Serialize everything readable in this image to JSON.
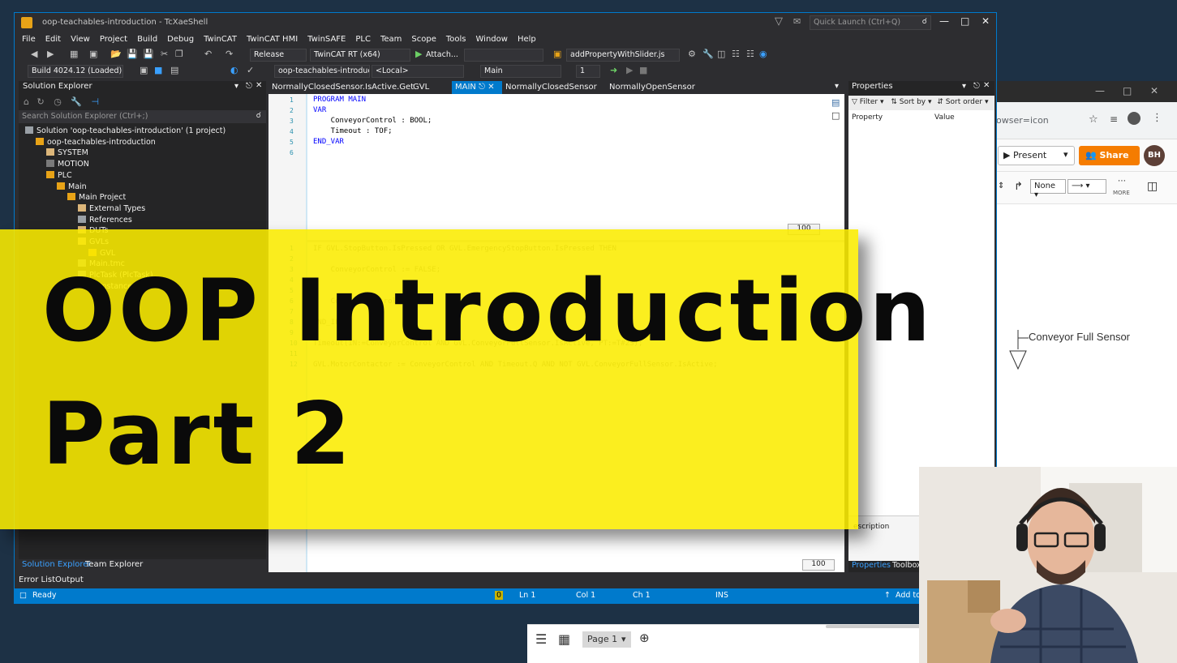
{
  "ide": {
    "title": "oop-teachables-introduction - TcXaeShell",
    "quick_launch": "Quick Launch (Ctrl+Q)",
    "menu": [
      "File",
      "Edit",
      "View",
      "Project",
      "Build",
      "Debug",
      "TwinCAT",
      "TwinCAT HMI",
      "TwinSAFE",
      "PLC",
      "Team",
      "Scope",
      "Tools",
      "Window",
      "Help"
    ],
    "toolbar1": {
      "config": "Release",
      "platform": "TwinCAT RT (x64)",
      "attach": "Attach...",
      "script": "addPropertyWithSlider.js"
    },
    "toolbar2": {
      "build": "Build 4024.12 (Loaded)",
      "project": "oop-teachables-introduc",
      "target": "<Local>",
      "task": "Main",
      "instance": "1"
    },
    "solution_explorer": {
      "header": "Solution Explorer",
      "search_placeholder": "Search Solution Explorer (Ctrl+;)",
      "items": [
        {
          "label": "Solution 'oop-teachables-introduction' (1 project)",
          "indent": 0,
          "icon": "solution"
        },
        {
          "label": "oop-teachables-introduction",
          "indent": 1,
          "icon": "project"
        },
        {
          "label": "SYSTEM",
          "indent": 2,
          "icon": "folder"
        },
        {
          "label": "MOTION",
          "indent": 2,
          "icon": "motion"
        },
        {
          "label": "PLC",
          "indent": 2,
          "icon": "plc"
        },
        {
          "label": "Main",
          "indent": 3,
          "icon": "plc"
        },
        {
          "label": "Main Project",
          "indent": 4,
          "icon": "project"
        },
        {
          "label": "External Types",
          "indent": 5,
          "icon": "folder"
        },
        {
          "label": "References",
          "indent": 5,
          "icon": "references"
        },
        {
          "label": "DUTs",
          "indent": 5,
          "icon": "folder"
        },
        {
          "label": "GVLs",
          "indent": 5,
          "icon": "folder"
        },
        {
          "label": "GVL",
          "indent": 6,
          "icon": "gvl"
        },
        {
          "label": "Main.tmc",
          "indent": 5,
          "icon": "file"
        },
        {
          "label": "PlcTask (PlcTask)",
          "indent": 5,
          "icon": "task"
        },
        {
          "label": "Main Instance",
          "indent": 4,
          "icon": "instance"
        }
      ],
      "tabs": [
        "Solution Explorer",
        "Team Explorer"
      ]
    },
    "bottom_tabs": [
      "Error List",
      "Output"
    ],
    "doc_tabs": [
      {
        "label": "NormallyClosedSensor.IsActive.Get",
        "active": false
      },
      {
        "label": "GVL",
        "active": false
      },
      {
        "label": "MAIN",
        "active": true
      },
      {
        "label": "NormallyClosedSensor",
        "active": false
      },
      {
        "label": "NormallyOpenSensor",
        "active": false
      }
    ],
    "editor": {
      "declaration": [
        {
          "n": "1",
          "text": "PROGRAM MAIN",
          "kw": true
        },
        {
          "n": "2",
          "text": "VAR",
          "kw": true
        },
        {
          "n": "3",
          "text": "    ConveyorControl : BOOL;",
          "kw": false
        },
        {
          "n": "4",
          "text": "    Timeout : TOF;",
          "kw": false
        },
        {
          "n": "5",
          "text": "END_VAR",
          "kw": true
        },
        {
          "n": "6",
          "text": "",
          "kw": false
        }
      ],
      "implementation": [
        {
          "n": "1",
          "text": "IF GVL.StopButton.IsPressed OR GVL.EmergencyStopButton.IsPressed THEN"
        },
        {
          "n": "2",
          "text": ""
        },
        {
          "n": "3",
          "text": "    ConveyorControl := FALSE;"
        },
        {
          "n": "4",
          "text": ""
        },
        {
          "n": "5",
          "text": ""
        },
        {
          "n": "6",
          "text": "    ConveyorControl"
        },
        {
          "n": "7",
          "text": ""
        },
        {
          "n": "8",
          "text": "END_IF"
        },
        {
          "n": "9",
          "text": ""
        },
        {
          "n": "10",
          "text": "Timeout(IN:=ConveyorControl AND GVL.ConveyorFullSensor.IsActive, PT:=T#2S);"
        },
        {
          "n": "11",
          "text": ""
        },
        {
          "n": "12",
          "text": "GVL.MotorContactor := ConveyorControl AND Timeout.Q AND NOT GVL.ConveyorFullSensor.IsActive;"
        }
      ],
      "zoom_top": "100",
      "zoom_bottom": "100"
    },
    "properties": {
      "header": "Properties",
      "filter": "Filter",
      "sort_by": "Sort by",
      "sort_order": "Sort order",
      "col_property": "Property",
      "col_value": "Value",
      "description": "escription",
      "tabs": [
        "Properties",
        "Toolbox"
      ]
    },
    "status": {
      "ready": "Ready",
      "ln": "Ln 1",
      "col": "Col 1",
      "ch": "Ch 1",
      "mode": "INS",
      "add_to": "Add to",
      "badge": "0"
    }
  },
  "browser": {
    "address": "owser=icon",
    "present": "Present",
    "share": "Share",
    "avatar": "BH",
    "line_style": "None",
    "more": "MORE",
    "canvas_label": "Conveyor Full Sensor",
    "page_tab": "Page 1"
  },
  "overlay": {
    "line1": "OOP Introduction",
    "line2": "Part 2"
  },
  "colors": {
    "accent": "#007acc",
    "banner": "#faec00",
    "share": "#f57c00"
  }
}
